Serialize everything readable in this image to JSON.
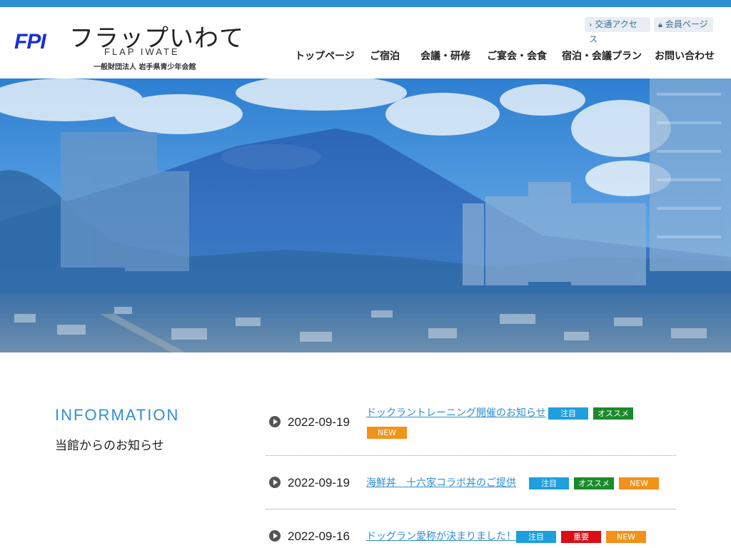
{
  "header": {
    "logo_mark": "FPI",
    "logo_name": "フラップいわて",
    "logo_en": "FLAP IWATE",
    "logo_org": "一般財団法人 岩手県青少年会館",
    "util_links": [
      {
        "label": "交通アクセス",
        "icon": "chevron-right-icon"
      },
      {
        "label": "会員ページ",
        "icon": "lock-icon"
      }
    ],
    "nav": [
      "トップページ",
      "ご宿泊",
      "会議・研修",
      "ご宴会・会食",
      "宿泊・会議プラン",
      "お問い合わせ"
    ]
  },
  "hero": {
    "image": "mountain-and-city-skyline-photo"
  },
  "information": {
    "title": "INFORMATION",
    "subtitle": "当館からのお知らせ",
    "items": [
      {
        "date": "2022-09-19",
        "title": "ドックラントレーニング開催のお知らせ",
        "tags": [
          "注目",
          "オススメ",
          "NEW"
        ]
      },
      {
        "date": "2022-09-19",
        "title": "海鮮丼　十六家コラボ丼のご提供",
        "tags": [
          "注目",
          "オススメ",
          "NEW"
        ]
      },
      {
        "date": "2022-09-16",
        "title": "ドッグラン愛称が決まりました！",
        "tags": [
          "注目",
          "重要",
          "NEW"
        ]
      }
    ]
  },
  "colors": {
    "accent": "#2f8fd3",
    "tag_note": "#1e9fde",
    "tag_recommend": "#1a8a2a",
    "tag_new": "#f39219",
    "tag_important": "#d90f16"
  }
}
